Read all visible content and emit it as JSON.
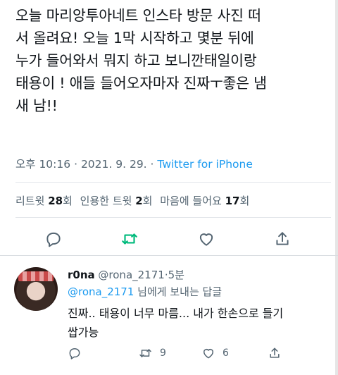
{
  "tweet": {
    "text": "오늘 마리앙투아네트 인스타 방문 사진 떠\n서 올려요! 오늘 1막 시작하고 몇분 뒤에\n누가 들어와서 뭐지 하고 보니깐태일이랑\n태용이 ! 애들 들어오자마자 진짜ㅜ좋은 냄\n새 남!!",
    "time": "오후 10:16",
    "date": "2021. 9. 29.",
    "separator": "·",
    "source": "Twitter for iPhone"
  },
  "stats": {
    "retweets_label": "리트윗",
    "retweets_count": "28",
    "retweets_unit": "회",
    "quotes_label": "인용한 트윗",
    "quotes_count": "2",
    "quotes_unit": "회",
    "likes_label": "마음에 들어요",
    "likes_count": "17",
    "likes_unit": "회"
  },
  "actions": {
    "reply_icon": "reply-icon",
    "retweet_icon": "retweet-icon",
    "like_icon": "heart-icon",
    "share_icon": "share-icon",
    "retweet_color": "#00ba7c",
    "icon_color": "#536471"
  },
  "reply": {
    "name": "r0na",
    "handle": "@rona_2171",
    "separator": "·",
    "time": "5분",
    "reply_to_handle": "@rona_2171",
    "reply_to_suffix": "님에게 보내는 답글",
    "text": "진짜.. 태용이 너무 마름... 내가 한손으로 들기\n쌉가능",
    "reply_count": "",
    "retweet_count": "9",
    "like_count": "6"
  }
}
